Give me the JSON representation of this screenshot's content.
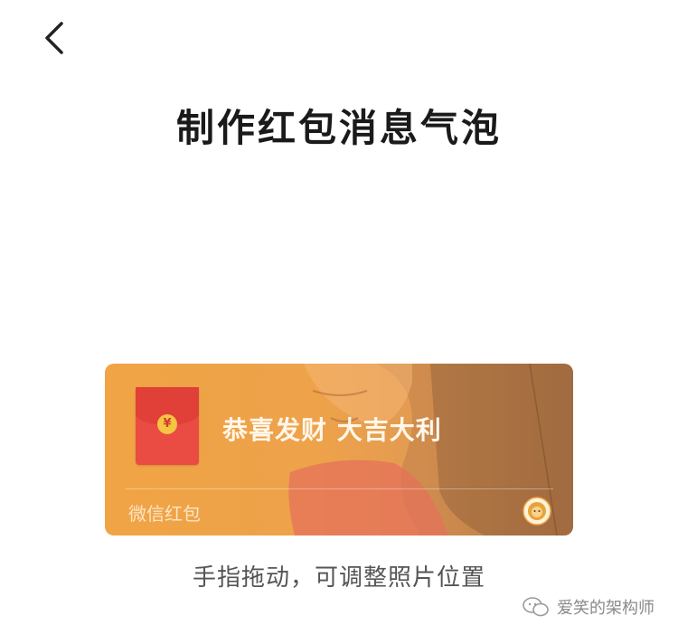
{
  "header": {
    "back_icon": "chevron-left-icon",
    "title": "制作红包消息气泡"
  },
  "bubble": {
    "message": "恭喜发财 大吉大利",
    "footer_label": "微信红包",
    "coin_symbol": "¥",
    "badge_icon": "lion-badge-icon",
    "envelope_icon": "red-envelope-icon",
    "colors": {
      "envelope": "#ea4c43",
      "coin": "#f5c443",
      "background": "#eea24a"
    }
  },
  "hint": "手指拖动，可调整照片位置",
  "watermark": {
    "icon": "wechat-official-account-icon",
    "text": "爱笑的架构师"
  }
}
